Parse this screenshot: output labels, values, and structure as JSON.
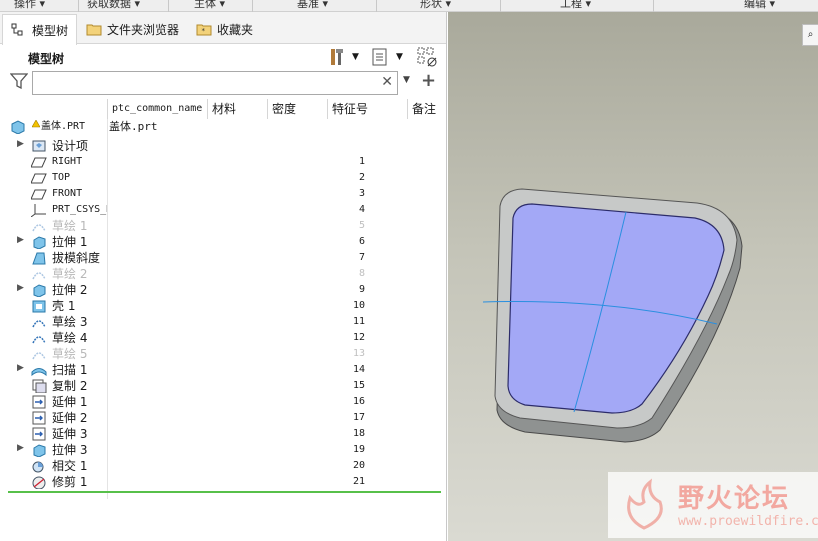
{
  "ribbon": {
    "groups": [
      "操作 ▾",
      "获取数据 ▾",
      "主体 ▾",
      "基准 ▾",
      "形状 ▾",
      "工程 ▾",
      "编辑 ▾"
    ]
  },
  "tabs": [
    {
      "label": "模型树"
    },
    {
      "label": "文件夹浏览器"
    },
    {
      "label": "收藏夹"
    }
  ],
  "tree": {
    "title": "模型树",
    "search": {
      "value": "",
      "placeholder": ""
    },
    "columns": [
      "ptc_common_name",
      "材料",
      "密度",
      "特征号",
      "备注"
    ],
    "root": {
      "label": "盖体.PRT",
      "common_name": "盖体.prt"
    },
    "items": [
      {
        "label": "设计项",
        "num": "",
        "icon": "design-items-icon",
        "expand": true,
        "mono": false,
        "dim": false
      },
      {
        "label": "RIGHT",
        "num": "1",
        "icon": "datum-plane-icon",
        "expand": false,
        "mono": true,
        "dim": false
      },
      {
        "label": "TOP",
        "num": "2",
        "icon": "datum-plane-icon",
        "expand": false,
        "mono": true,
        "dim": false
      },
      {
        "label": "FRONT",
        "num": "3",
        "icon": "datum-plane-icon",
        "expand": false,
        "mono": true,
        "dim": false
      },
      {
        "label": "PRT_CSYS_DEF",
        "num": "4",
        "icon": "csys-icon",
        "expand": false,
        "mono": true,
        "dim": false
      },
      {
        "label": "草绘 1",
        "num": "5",
        "icon": "sketch-icon",
        "expand": false,
        "mono": false,
        "dim": true
      },
      {
        "label": "拉伸 1",
        "num": "6",
        "icon": "extrude-icon",
        "expand": true,
        "mono": false,
        "dim": false
      },
      {
        "label": "拔模斜度",
        "num": "7",
        "icon": "draft-icon",
        "expand": false,
        "mono": false,
        "dim": false
      },
      {
        "label": "草绘 2",
        "num": "8",
        "icon": "sketch-icon",
        "expand": false,
        "mono": false,
        "dim": true
      },
      {
        "label": "拉伸 2",
        "num": "9",
        "icon": "extrude-icon",
        "expand": true,
        "mono": false,
        "dim": false
      },
      {
        "label": "壳 1",
        "num": "10",
        "icon": "shell-icon",
        "expand": false,
        "mono": false,
        "dim": false
      },
      {
        "label": "草绘 3",
        "num": "11",
        "icon": "sketch-icon",
        "expand": false,
        "mono": false,
        "dim": false
      },
      {
        "label": "草绘 4",
        "num": "12",
        "icon": "sketch-icon",
        "expand": false,
        "mono": false,
        "dim": false
      },
      {
        "label": "草绘 5",
        "num": "13",
        "icon": "sketch-icon",
        "expand": false,
        "mono": false,
        "dim": true
      },
      {
        "label": "扫描 1",
        "num": "14",
        "icon": "sweep-icon",
        "expand": true,
        "mono": false,
        "dim": false
      },
      {
        "label": "复制 2",
        "num": "15",
        "icon": "copy-icon",
        "expand": false,
        "mono": false,
        "dim": false
      },
      {
        "label": "延伸 1",
        "num": "16",
        "icon": "extend-icon",
        "expand": false,
        "mono": false,
        "dim": false
      },
      {
        "label": "延伸 2",
        "num": "17",
        "icon": "extend-icon",
        "expand": false,
        "mono": false,
        "dim": false
      },
      {
        "label": "延伸 3",
        "num": "18",
        "icon": "extend-icon",
        "expand": false,
        "mono": false,
        "dim": false
      },
      {
        "label": "拉伸 3",
        "num": "19",
        "icon": "extrude-icon",
        "expand": true,
        "mono": false,
        "dim": false
      },
      {
        "label": "相交 1",
        "num": "20",
        "icon": "intersect-icon",
        "expand": false,
        "mono": false,
        "dim": false
      },
      {
        "label": "修剪 1",
        "num": "21",
        "icon": "trim-icon",
        "expand": false,
        "mono": false,
        "dim": false
      }
    ]
  },
  "watermark": {
    "title": "野火论坛",
    "url": "www.proewildfire.cn"
  },
  "colors": {
    "surface": "#a3a8f6",
    "insert_line": "#57c04a",
    "datum_curve": "#2a8fe0"
  }
}
